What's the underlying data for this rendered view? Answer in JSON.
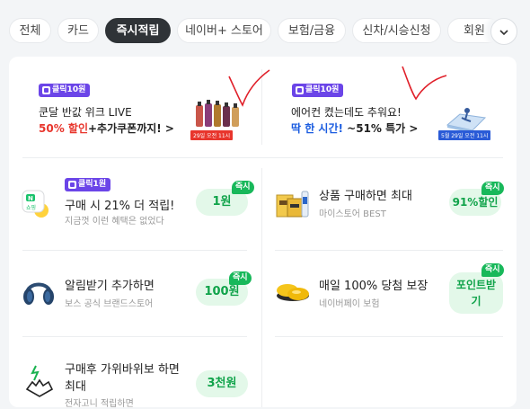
{
  "tabs": [
    {
      "label": "전체",
      "active": false
    },
    {
      "label": "카드",
      "active": false
    },
    {
      "label": "즉시적립",
      "active": true
    },
    {
      "label": "네이버+ 스토어",
      "active": false
    },
    {
      "label": "보험/금융",
      "active": false
    },
    {
      "label": "신차/시승신청",
      "active": false
    },
    {
      "label": "회원",
      "active": false
    }
  ],
  "banners": [
    {
      "badge": "클릭10원",
      "line1": "쿤달 반값 위크 LIVE",
      "line2_highlight": "50% 할인",
      "line2_rest": "+추가쿠폰까지! >",
      "stamp": "29일 오전 11시"
    },
    {
      "badge": "클릭10원",
      "line1": "에어컨 켰는데도 추워요!",
      "line2_highlight": "딱 한 시간!",
      "line2_rest": " ~51% 특가 >",
      "stamp": "5월 29일 오전 11시"
    }
  ],
  "offers": [
    {
      "badge": "클릭1원",
      "title": "구매 시 21% 더 적립!",
      "subtitle": "지금껏 이런 혜택은 없었다",
      "button": "1원",
      "instant": "즉시",
      "icon_label": "N 쇼핑"
    },
    {
      "title": "상품 구매하면 최대",
      "subtitle": "마이스토어 BEST",
      "button": "91%할인",
      "instant": "즉시"
    },
    {
      "title": "알림받기 추가하면",
      "subtitle": "보스 공식 브랜드스토어",
      "button": "100원",
      "instant": "즉시"
    },
    {
      "title": "매일 100% 당첨 보장",
      "subtitle": "네이버페이 보험",
      "button_line1": "포인트받",
      "button_line2": "기",
      "instant": "즉시"
    },
    {
      "title_line1": "구매후 가위바위보 하면",
      "title_line2": "최대",
      "subtitle": "전자고니 적립하면",
      "button": "3천원"
    }
  ],
  "colors": {
    "accent_purple": "#6b45e8",
    "green": "#18b85a",
    "green_text": "#10a34a",
    "red": "#e8352c",
    "blue": "#1a5ce0",
    "annotation_red": "#e0202a"
  }
}
